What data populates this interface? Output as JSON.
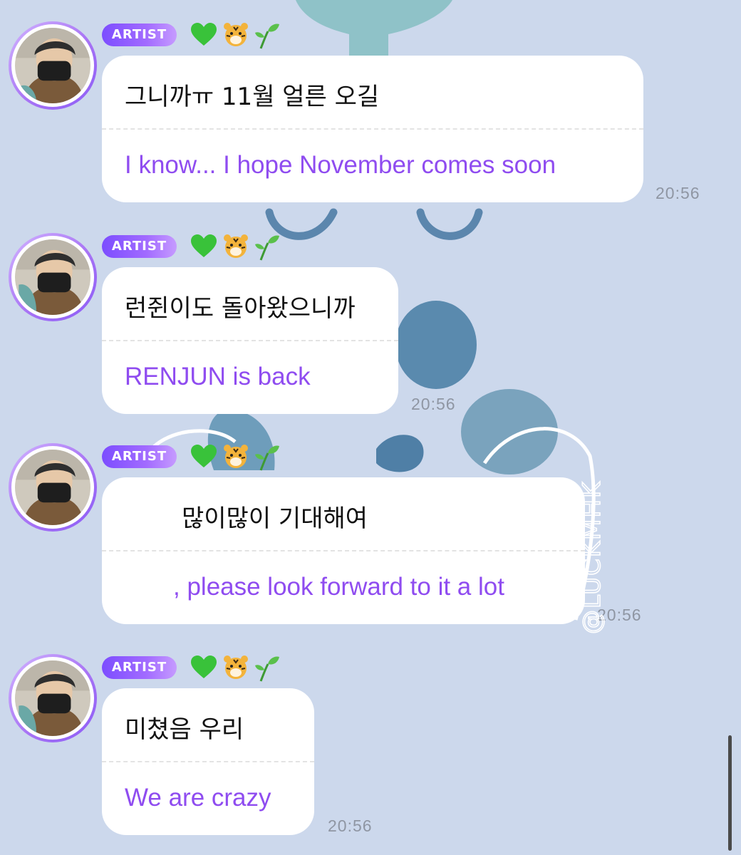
{
  "colors": {
    "background": "#ccd8ec",
    "badge_gradient_start": "#7c4dff",
    "badge_gradient_end": "#c69bff",
    "translation_text": "#8f4cf0",
    "timestamp": "#8f96a3"
  },
  "messages": [
    {
      "badge": "ARTIST",
      "emojis": [
        "green-heart",
        "tiger-face",
        "seedling"
      ],
      "text_ko": "그니까ㅠ 11월 얼른 오길",
      "text_en": "I know... I hope November comes soon",
      "time": "20:56"
    },
    {
      "badge": "ARTIST",
      "emojis": [
        "green-heart",
        "tiger-face",
        "seedling"
      ],
      "text_ko": "런쥔이도 돌아왔으니까",
      "text_en": "RENJUN is back",
      "time": "20:56"
    },
    {
      "badge": "ARTIST",
      "emojis": [
        "green-heart",
        "tiger-face",
        "seedling"
      ],
      "text_ko": "많이많이 기대해여",
      "text_en": ", please look forward to it a lot",
      "time": "20:56"
    },
    {
      "badge": "ARTIST",
      "emojis": [
        "green-heart",
        "tiger-face",
        "seedling"
      ],
      "text_ko": "미쳤음 우리",
      "text_en": "We are crazy",
      "time": "20:56"
    }
  ],
  "watermark": "@LUCKMHK"
}
